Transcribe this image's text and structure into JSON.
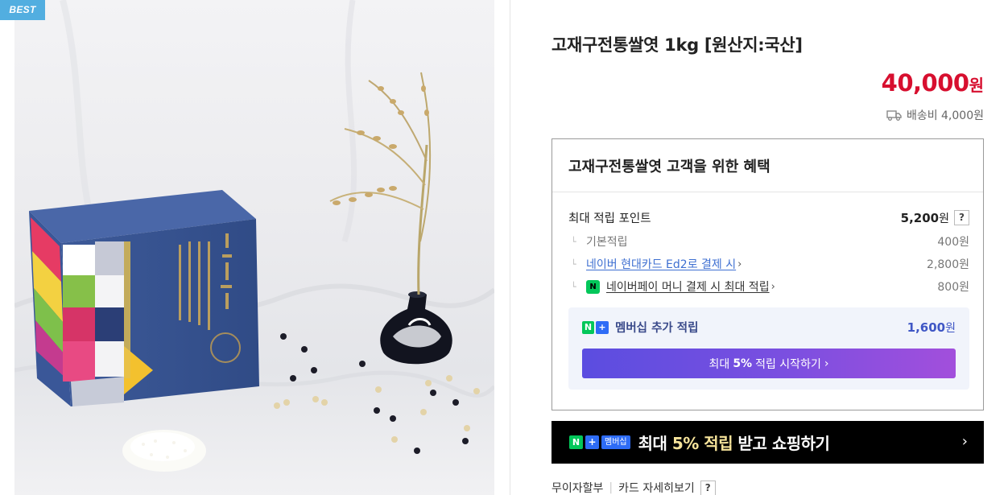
{
  "product": {
    "badge": "BEST",
    "title": "고재구전통쌀엿 1kg [원산지:국산]",
    "price": "40,000",
    "price_unit": "원",
    "shipping": "배송비 4,000원"
  },
  "benefit": {
    "heading": "고재구전통쌀엿 고객을 위한 혜택",
    "max_points_label": "최대 적립 포인트",
    "max_points_value": "5,200",
    "won": "원",
    "help_mark": "?",
    "items": [
      {
        "label": "기본적립",
        "amount": "400원"
      },
      {
        "label": "네이버 현대카드 Ed2로 결제 시",
        "amount": "2,800원"
      },
      {
        "label": "네이버페이 머니 결제 시 최대 적립",
        "amount": "800원"
      }
    ],
    "membership_label": "멤버십 추가 적립",
    "membership_value": "1,600",
    "start_prefix": "최대",
    "start_bold": "5%",
    "start_suffix": "적립 시작하기"
  },
  "banner": {
    "tag_n": "N",
    "tag_plus": "+",
    "tag_member": "멤버십",
    "text_before": "최대 ",
    "text_highlight": "5% 적립",
    "text_after": " 받고 쇼핑하기",
    "arrow": "›"
  },
  "footer": {
    "installment": "무이자할부",
    "card_details": "카드 자세히보기",
    "help_mark": "?"
  },
  "colors": {
    "price_red": "#d70f2f",
    "badge_blue": "#52aee0",
    "naver_green": "#03c75a",
    "link_blue": "#3e6fd1",
    "member_purple": "#3f57c5"
  },
  "icons": [
    "truck-icon",
    "chevron-right-icon",
    "npay-icon",
    "nplus-icon",
    "help-icon"
  ]
}
